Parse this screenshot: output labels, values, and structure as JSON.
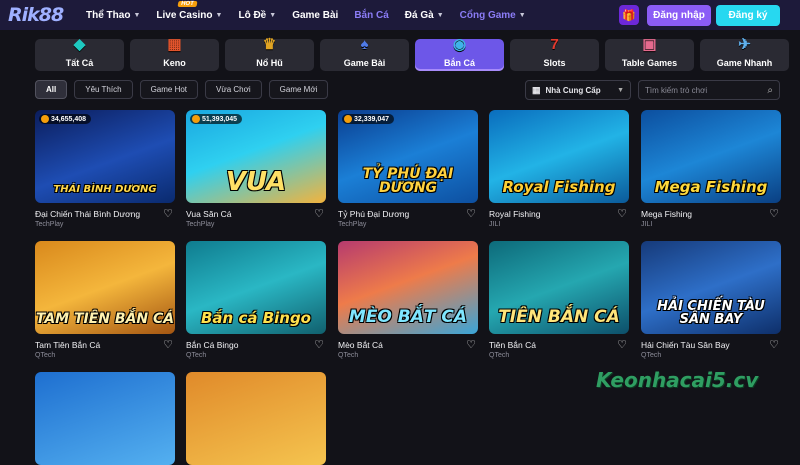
{
  "header": {
    "logo": "Rik88",
    "nav": [
      {
        "label": "Thể Thao",
        "caret": true,
        "hot": false,
        "active": false
      },
      {
        "label": "Live Casino",
        "caret": true,
        "hot": true,
        "active": false
      },
      {
        "label": "Lô Đề",
        "caret": true,
        "hot": false,
        "active": false
      },
      {
        "label": "Game Bài",
        "caret": false,
        "hot": false,
        "active": false
      },
      {
        "label": "Bắn Cá",
        "caret": false,
        "hot": false,
        "active": true
      },
      {
        "label": "Đá Gà",
        "caret": true,
        "hot": false,
        "active": false
      },
      {
        "label": "Cổng Game",
        "caret": true,
        "hot": false,
        "active": true
      }
    ],
    "hot_label": "HOT",
    "login_label": "Đăng nhập",
    "register_label": "Đăng ký"
  },
  "categories": [
    {
      "label": "Tất Cả",
      "icon": "diamond-icon",
      "glyph": "◆",
      "color": "#1ec9c0",
      "active": false
    },
    {
      "label": "Keno",
      "icon": "keno-grid-icon",
      "glyph": "▦",
      "color": "#e3542c",
      "active": false
    },
    {
      "label": "Nổ Hũ",
      "icon": "jackpot-pot-icon",
      "glyph": "♛",
      "color": "#e0a423",
      "active": false
    },
    {
      "label": "Game Bài",
      "icon": "cards-icon",
      "glyph": "♠",
      "color": "#4f7be8",
      "active": false
    },
    {
      "label": "Bắn Cá",
      "icon": "fish-icon",
      "glyph": "◉",
      "color": "#3fb3e8",
      "active": true
    },
    {
      "label": "Slots",
      "icon": "slot-seven-icon",
      "glyph": "7",
      "color": "#e23a2e",
      "active": false
    },
    {
      "label": "Table Games",
      "icon": "table-games-icon",
      "glyph": "▣",
      "color": "#e56a8e",
      "active": false
    },
    {
      "label": "Game Nhanh",
      "icon": "fast-game-icon",
      "glyph": "✈",
      "color": "#5fb0ec",
      "active": false
    }
  ],
  "filters": [
    {
      "label": "All",
      "active": true
    },
    {
      "label": "Yêu Thích",
      "active": false
    },
    {
      "label": "Game Hot",
      "active": false
    },
    {
      "label": "Vừa Chơi",
      "active": false
    },
    {
      "label": "Game Mới",
      "active": false
    }
  ],
  "provider_select": {
    "label": "Nhà Cung Cấp"
  },
  "search": {
    "placeholder": "Tìm kiếm trò chơi"
  },
  "games": [
    {
      "name": "Đại Chiến Thái Bình Dương",
      "provider": "TechPlay",
      "jackpot": "34,655,408",
      "art": "THÁI BÌNH DƯƠNG",
      "bg": "linear-gradient(160deg,#0b1d5c,#1e4db3 55%,#0a2a6e)",
      "fg": "#ffd84a",
      "size": 10
    },
    {
      "name": "Vua Săn Cá",
      "provider": "TechPlay",
      "jackpot": "51,393,045",
      "art": "VUA",
      "bg": "linear-gradient(160deg,#1aa7e0,#2fd0f0 45%,#f3b33d)",
      "fg": "#ffe066",
      "size": 26
    },
    {
      "name": "Tỷ Phú Đại Dương",
      "provider": "TechPlay",
      "jackpot": "32,339,047",
      "art": "TỶ PHÚ ĐẠI DƯƠNG",
      "bg": "linear-gradient(160deg,#0a3d8f,#1b7fd6 50%,#0d4fa0)",
      "fg": "#ffd23f",
      "size": 14
    },
    {
      "name": "Royal Fishing",
      "provider": "JILI",
      "jackpot": "",
      "art": "Royal Fishing",
      "bg": "linear-gradient(160deg,#0a6dbd,#22b3e6 50%,#0b5a9a)",
      "fg": "#ffcf33",
      "size": 15
    },
    {
      "name": "Mega Fishing",
      "provider": "JILI",
      "jackpot": "",
      "art": "Mega Fishing",
      "bg": "linear-gradient(160deg,#0c4f9f,#1d86d6 50%,#0a3f82)",
      "fg": "#ffd93b",
      "size": 15
    },
    {
      "name": "Tam Tiên Bắn Cá",
      "provider": "QTech",
      "jackpot": "",
      "art": "TAM TIÊN BẮN CÁ",
      "bg": "linear-gradient(160deg,#d9891c,#f4b63c 50%,#a35512)",
      "fg": "#fff2b0",
      "size": 14
    },
    {
      "name": "Bắn Cá Bingo",
      "provider": "QTech",
      "jackpot": "",
      "art": "Bắn cá Bingo",
      "bg": "linear-gradient(160deg,#0f7c8f,#2ab7c4 50%,#11606e)",
      "fg": "#ffe14d",
      "size": 15
    },
    {
      "name": "Mèo Bắt Cá",
      "provider": "QTech",
      "jackpot": "",
      "art": "MÈO BẮT CÁ",
      "bg": "linear-gradient(160deg,#b63a6e,#ee7b4a 45%,#3aa5d8)",
      "fg": "#7fe6ff",
      "size": 17
    },
    {
      "name": "Tiên Bắn Cá",
      "provider": "QTech",
      "jackpot": "",
      "art": "TIÊN BẮN CÁ",
      "bg": "linear-gradient(160deg,#0d6a7a,#25a7b0 50%,#0d4f6a)",
      "fg": "#ffe57a",
      "size": 17
    },
    {
      "name": "Hải Chiến Tàu Sân Bay",
      "provider": "QTech",
      "jackpot": "",
      "art": "HẢI CHIẾN TÀU SÂN BAY",
      "bg": "linear-gradient(160deg,#163a7a,#2e6fc8 50%,#0e2f6a)",
      "fg": "#ffffff",
      "size": 13
    }
  ],
  "partial_row": [
    {
      "bg": "linear-gradient(160deg,#1e6fd0,#54b0f0)"
    },
    {
      "bg": "linear-gradient(160deg,#e08a2a,#f5c44f)"
    }
  ],
  "watermark": "Keonhacai5.cv"
}
